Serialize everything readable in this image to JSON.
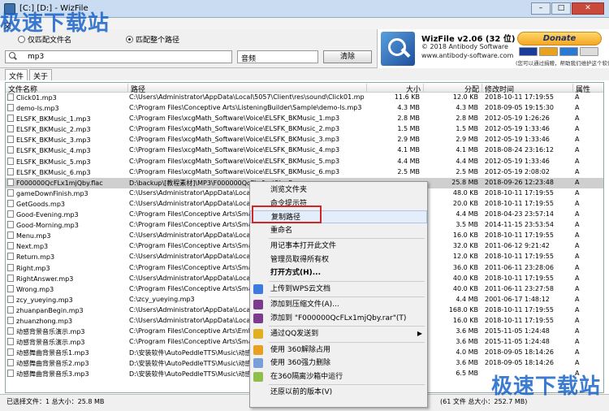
{
  "window": {
    "title": "[C:] [D:] - WizFile",
    "app_icon": "wizfile-icon"
  },
  "window_controls": {
    "minimize": "–",
    "maximize": "□",
    "close": "✕"
  },
  "watermarks": {
    "top": "极速下载站",
    "bottom": "极速下载站"
  },
  "menu": {
    "file": "文"
  },
  "options": {
    "match_filename": "仅匹配文件名",
    "match_path": "匹配整个路径",
    "selected": "match_path"
  },
  "search": {
    "value": "mp3",
    "placeholder": ""
  },
  "type_filter": "音频",
  "clear_label": "清除",
  "brand": {
    "name": "WizFile v2.06 (32 位)",
    "copyright": "© 2018 Antibody Software",
    "website": "www.antibody-software.com",
    "donate": "Donate",
    "donate_note": "(您可以通过捐赠，帮助我们维护这个软件)",
    "card_colors": [
      "#1a3d9c",
      "#e9a21c",
      "#2a7ad4",
      "#dcdcdc"
    ]
  },
  "tabs": [
    "文件",
    "关于"
  ],
  "columns": {
    "name": "文件名称",
    "path": "路径",
    "size": "大小",
    "alloc": "分配",
    "modified": "修改时间",
    "attr": "属性"
  },
  "rows": [
    {
      "name": "Click01.mp3",
      "path": "C:\\Users\\Administrator\\AppData\\Local\\5057\\Client\\res\\sound\\Click01.mp3",
      "size": "11.6 KB",
      "alloc": "12.0 KB",
      "date": "2018-10-11 17:19:55",
      "attr": "A"
    },
    {
      "name": "demo-ls.mp3",
      "path": "C:\\Program Files\\Conceptive Arts\\ListeningBuilder\\Sample\\demo-ls.mp3",
      "size": "4.3 MB",
      "alloc": "4.3 MB",
      "date": "2018-09-05 19:15:30",
      "attr": "A"
    },
    {
      "name": "ELSFK_BKMusic_1.mp3",
      "path": "C:\\Program Files\\xcgMath_Software\\Voice\\ELSFK_BKMusic_1.mp3",
      "size": "2.8 MB",
      "alloc": "2.8 MB",
      "date": "2012-05-19 1:26:26",
      "attr": "A"
    },
    {
      "name": "ELSFK_BKMusic_2.mp3",
      "path": "C:\\Program Files\\xcgMath_Software\\Voice\\ELSFK_BKMusic_2.mp3",
      "size": "1.5 MB",
      "alloc": "1.5 MB",
      "date": "2012-05-19 1:33:46",
      "attr": "A"
    },
    {
      "name": "ELSFK_BKMusic_3.mp3",
      "path": "C:\\Program Files\\xcgMath_Software\\Voice\\ELSFK_BKMusic_3.mp3",
      "size": "2.9 MB",
      "alloc": "2.9 MB",
      "date": "2012-05-19 1:33:46",
      "attr": "A"
    },
    {
      "name": "ELSFK_BKMusic_4.mp3",
      "path": "C:\\Program Files\\xcgMath_Software\\Voice\\ELSFK_BKMusic_4.mp3",
      "size": "4.1 MB",
      "alloc": "4.1 MB",
      "date": "2018-08-24 23:16:12",
      "attr": "A"
    },
    {
      "name": "ELSFK_BKMusic_5.mp3",
      "path": "C:\\Program Files\\xcgMath_Software\\Voice\\ELSFK_BKMusic_5.mp3",
      "size": "4.4 MB",
      "alloc": "4.4 MB",
      "date": "2012-05-19 1:33:46",
      "attr": "A"
    },
    {
      "name": "ELSFK_BKMusic_6.mp3",
      "path": "C:\\Program Files\\xcgMath_Software\\Voice\\ELSFK_BKMusic_6.mp3",
      "size": "2.5 MB",
      "alloc": "2.5 MB",
      "date": "2012-05-19 2:08:02",
      "attr": "A"
    },
    {
      "name": "F000000QcFLx1mjQby.flac",
      "path": "D:\\backup\\[教程素材]\\MP3\\F000000QcFLx1mjQby.flac",
      "size": "",
      "alloc": "25.8 MB",
      "date": "2018-09-26 12:23:48",
      "attr": "A",
      "selected": true
    },
    {
      "name": "gameDownFinish.mp3",
      "path": "C:\\Users\\Administrator\\AppData\\Local\\505",
      "size": "",
      "alloc": "48.0 KB",
      "date": "2018-10-11 17:19:55",
      "attr": "A"
    },
    {
      "name": "GetGoods.mp3",
      "path": "C:\\Users\\Administrator\\AppData\\Local\\505",
      "size": "",
      "alloc": "20.0 KB",
      "date": "2018-10-11 17:19:55",
      "attr": "A"
    },
    {
      "name": "Good-Evening.mp3",
      "path": "C:\\Program Files\\Conceptive Arts\\SmartM",
      "size": "",
      "alloc": "4.4 MB",
      "date": "2018-04-23 23:57:14",
      "attr": "A"
    },
    {
      "name": "Good-Morning.mp3",
      "path": "C:\\Program Files\\Conceptive Arts\\SmartM",
      "size": "",
      "alloc": "3.5 MB",
      "date": "2014-11-15 23:53:54",
      "attr": "A"
    },
    {
      "name": "Menu.mp3",
      "path": "C:\\Users\\Administrator\\AppData\\Local\\505",
      "size": "",
      "alloc": "16.0 KB",
      "date": "2018-10-11 17:19:55",
      "attr": "A"
    },
    {
      "name": "Next.mp3",
      "path": "C:\\Program Files\\Conceptive Arts\\SmartM",
      "size": "",
      "alloc": "32.0 KB",
      "date": "2011-06-12 9:21:42",
      "attr": "A"
    },
    {
      "name": "Return.mp3",
      "path": "C:\\Users\\Administrator\\AppData\\Local\\505",
      "size": "",
      "alloc": "12.0 KB",
      "date": "2018-10-11 17:19:55",
      "attr": "A"
    },
    {
      "name": "Right.mp3",
      "path": "C:\\Program Files\\Conceptive Arts\\SmartM",
      "size": "",
      "alloc": "36.0 KB",
      "date": "2011-06-11 23:28:06",
      "attr": "A"
    },
    {
      "name": "RightAnswer.mp3",
      "path": "C:\\Users\\Administrator\\AppData\\Local\\505",
      "size": "",
      "alloc": "40.0 KB",
      "date": "2018-10-11 17:19:55",
      "attr": "A"
    },
    {
      "name": "Wrong.mp3",
      "path": "C:\\Program Files\\Conceptive Arts\\SmartM",
      "size": "",
      "alloc": "40.0 KB",
      "date": "2011-06-11 23:27:58",
      "attr": "A"
    },
    {
      "name": "zcy_yueying.mp3",
      "path": "C:\\zcy_yueying.mp3",
      "size": "",
      "alloc": "4.4 MB",
      "date": "2001-06-17 1:48:12",
      "attr": "A"
    },
    {
      "name": "zhuanpanBegin.mp3",
      "path": "C:\\Users\\Administrator\\AppData\\Local\\505",
      "size": "",
      "alloc": "168.0 KB",
      "date": "2018-10-11 17:19:55",
      "attr": "A"
    },
    {
      "name": "zhuanzhong.mp3",
      "path": "C:\\Users\\Administrator\\AppData\\Local\\505",
      "size": "",
      "alloc": "16.0 KB",
      "date": "2018-10-11 17:19:55",
      "attr": "A"
    },
    {
      "name": "动感背景音乐演示.mp3",
      "path": "C:\\Program Files\\Conceptive Arts\\EmPlaye",
      "size": "",
      "alloc": "3.6 MB",
      "date": "2015-11-05 1:24:48",
      "attr": "A"
    },
    {
      "name": "动感背景音乐演示.mp3",
      "path": "C:\\Program Files\\Conceptive Arts\\SmartM",
      "size": "",
      "alloc": "3.6 MB",
      "date": "2015-11-05 1:24:48",
      "attr": "A"
    },
    {
      "name": "动感舞曲背景音乐1.mp3",
      "path": "D:\\安装软件\\AutoPeddleTTS\\Music\\动感",
      "size": "",
      "alloc": "4.0 MB",
      "date": "2018-09-05 18:14:26",
      "attr": "A"
    },
    {
      "name": "动感舞曲背景音乐2.mp3",
      "path": "D:\\安装软件\\AutoPeddleTTS\\Music\\动感",
      "size": "",
      "alloc": "3.6 MB",
      "date": "2018-09-05 18:14:26",
      "attr": "A"
    },
    {
      "name": "动感舞曲背景音乐3.mp3",
      "path": "D:\\安装软件\\AutoPeddleTTS\\Music\\动感",
      "size": "",
      "alloc": "6.5 MB",
      "date": "",
      "attr": "A"
    }
  ],
  "status": {
    "left": "已选择文件：1  总大小：25.8 MB",
    "right": "(61 文件  总大小：252.7 MB)"
  },
  "context_menu": [
    {
      "label": "浏览文件夹",
      "icon": ""
    },
    {
      "label": "命令提示符",
      "icon": ""
    },
    {
      "label": "复制路径",
      "icon": "",
      "highlighted": true
    },
    {
      "label": "重命名",
      "icon": ""
    },
    {
      "sep": true
    },
    {
      "label": "用记事本打开此文件",
      "icon": ""
    },
    {
      "label": "管理员取得所有权",
      "icon": ""
    },
    {
      "label": "打开方式(H)...",
      "icon": "",
      "bold": true
    },
    {
      "sep": true
    },
    {
      "label": "上传到WPS云文档",
      "icon": "wps-cloud-icon",
      "color": "#3b7be0"
    },
    {
      "sep": true
    },
    {
      "label": "添加到压缩文件(A)...",
      "icon": "winrar-icon",
      "color": "#7b3b8f"
    },
    {
      "label": "添加到 \"F000000QcFLx1mjQby.rar\"(T)",
      "icon": "winrar-icon",
      "color": "#7b3b8f"
    },
    {
      "sep": true
    },
    {
      "label": "通过QQ发送到",
      "icon": "qq-icon",
      "color": "#e0b020",
      "submenu": true
    },
    {
      "sep": true
    },
    {
      "label": "使用 360解除占用",
      "icon": "360-unlock-icon",
      "color": "#e8a020"
    },
    {
      "label": "使用 360强力删除",
      "icon": "360-delete-icon",
      "color": "#7a9fd8"
    },
    {
      "label": "在360隔离沙箱中运行",
      "icon": "360-sandbox-icon",
      "color": "#8fbf4a"
    },
    {
      "sep": true
    },
    {
      "label": "还原以前的版本(V)",
      "icon": ""
    }
  ]
}
